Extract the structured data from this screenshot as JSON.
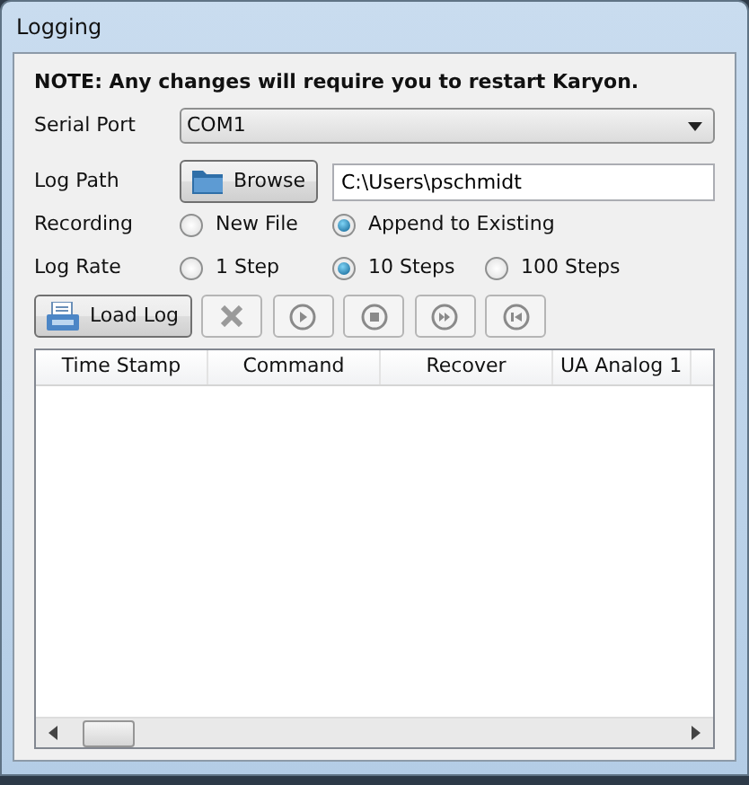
{
  "window": {
    "title": "Logging"
  },
  "note": "NOTE: Any changes will require you to restart Karyon.",
  "serial_port": {
    "label": "Serial Port",
    "value": "COM1"
  },
  "log_path": {
    "label": "Log Path",
    "button": "Browse",
    "value": "C:\\Users\\pschmidt"
  },
  "recording": {
    "label": "Recording",
    "options": [
      {
        "label": "New File",
        "selected": false
      },
      {
        "label": "Append to Existing",
        "selected": true
      }
    ]
  },
  "log_rate": {
    "label": "Log Rate",
    "options": [
      {
        "label": "1 Step",
        "selected": false
      },
      {
        "label": "10 Steps",
        "selected": true
      },
      {
        "label": "100 Steps",
        "selected": false
      }
    ]
  },
  "toolbar": [
    {
      "kind": "load",
      "label": "Load Log",
      "disabled": false
    },
    {
      "kind": "clear",
      "disabled": true
    },
    {
      "kind": "play",
      "disabled": true
    },
    {
      "kind": "stop",
      "disabled": true
    },
    {
      "kind": "fast_forward",
      "disabled": true
    },
    {
      "kind": "rewind",
      "disabled": true
    }
  ],
  "table": {
    "columns": [
      "Time Stamp",
      "Command",
      "Recover",
      "UA Analog 1"
    ]
  }
}
